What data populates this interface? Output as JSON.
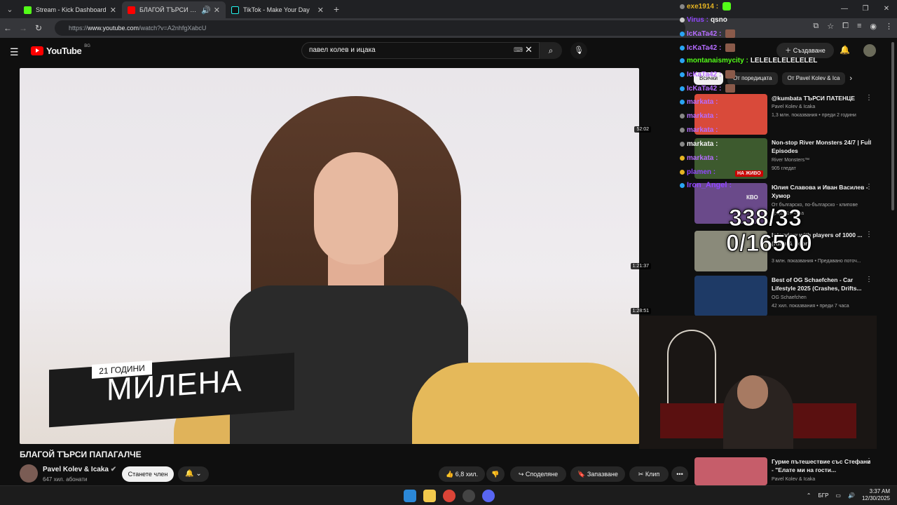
{
  "browser": {
    "tabs": [
      {
        "title": "Stream - Kick Dashboard",
        "color": "#53fc18"
      },
      {
        "title": "БЛАГОЙ ТЪРСИ ПАПАГАЛЧЕ",
        "color": "#ff0000"
      },
      {
        "title": "TikTok - Make Your Day",
        "color": "#111111"
      }
    ],
    "url_prefix": "https://",
    "url_host": "www.youtube.com",
    "url_path": "/watch?v=A2nhfgXabcU"
  },
  "youtube": {
    "logo": "YouTube",
    "country": "BG",
    "search_value": "павел колев и ицака",
    "create_label": "Създаване",
    "icons": [
      "menu-icon",
      "search-icon",
      "mic-icon",
      "bell-icon",
      "clear-icon",
      "keyboard-icon"
    ]
  },
  "video": {
    "overlay_age": "21 ГОДИНИ",
    "overlay_name": "МИЛЕНА",
    "title": "БЛАГОЙ ТЪРСИ ПАПАГАЛЧЕ",
    "channel": "Pavel Kolev & Icaka",
    "subscribers": "647 хил. абонати",
    "join_label": "Станете член",
    "likes": "6,8 хил.",
    "share_label": "Споделяне",
    "save_label": "Запазване",
    "clip_label": "Клип"
  },
  "chips": [
    "Всички",
    "От поредицата",
    "От Pavel Kolev & Ica"
  ],
  "suggestions": [
    {
      "title": "@kumbata ТЪРСИ ПАТЕНЦЕ",
      "channel": "Pavel Kolev & Icaka",
      "meta": "1,3 млн. показвания • преди 2 години",
      "duration": "52:02",
      "thumb": "#d94a3a"
    },
    {
      "title": "Non-stop River Monsters 24/7 | Full Episodes",
      "channel": "River Monsters™",
      "meta": "905 гледат",
      "live": "НА ЖИВО",
      "thumb": "#3d5a2e"
    },
    {
      "title": "Юлия Славова и Иван Василев - Хумор",
      "channel": "От българско, по-българско - клипове",
      "meta": "преди 10 часа",
      "badge": "КВО",
      "thumb": "#6a4a8a"
    },
    {
      "title": "Interview with players of 1000 ... (Rich & Poor)",
      "channel": "",
      "meta": "3 млн. показвания • Предавано поточ...",
      "duration": "1:21:37",
      "thumb": "#8a8a7a"
    },
    {
      "title": "Best of OG Schaefchen - Car Lifestyle 2025 (Crashes, Drifts...",
      "channel": "OG Schaefchen",
      "meta": "42 хил. показвания • преди 7 часа",
      "duration": "1:28:51",
      "thumb": "#1e3a66"
    },
    {
      "title": "Гурме пътешествие със Стефани - \"Елате ми на гости...",
      "channel": "Pavel Kolev & Icaka",
      "meta": "",
      "thumb": "#c65d6a"
    }
  ],
  "chat": [
    {
      "user": "exe1914 :",
      "msg": "",
      "color": "#e6b422"
    },
    {
      "user": "Virus :",
      "msg": "qsno",
      "color": "#9146ff"
    },
    {
      "user": "IcKaTa42 :",
      "msg": "",
      "color": "#b56cff"
    },
    {
      "user": "IcKaTa42 :",
      "msg": "",
      "color": "#b56cff"
    },
    {
      "user": "montanaismycity :",
      "msg": "LELELELELELELEL",
      "color": "#53fc18"
    },
    {
      "user": "IcKaTa42 :",
      "msg": "",
      "color": "#b56cff"
    },
    {
      "user": "IcKaTa42 :",
      "msg": "",
      "color": "#b56cff"
    },
    {
      "user": "markata :",
      "msg": "",
      "color": "#b56cff"
    },
    {
      "user": "markata :",
      "msg": "",
      "color": "#b56cff"
    },
    {
      "user": "markata :",
      "msg": "",
      "color": "#b56cff"
    },
    {
      "user": "markata :",
      "msg": "",
      "color": "#f1f1f1"
    },
    {
      "user": "markata :",
      "msg": "",
      "color": "#b56cff"
    },
    {
      "user": "plamen :",
      "msg": "",
      "color": "#9146ff"
    },
    {
      "user": "Iron_Angel :",
      "msg": "",
      "color": "#9146ff"
    }
  ],
  "goal": {
    "line1": "338/33",
    "line2": "0/16500"
  },
  "taskbar": {
    "lang": "БГР",
    "time": "3:37 AM",
    "date": "12/30/2025"
  }
}
